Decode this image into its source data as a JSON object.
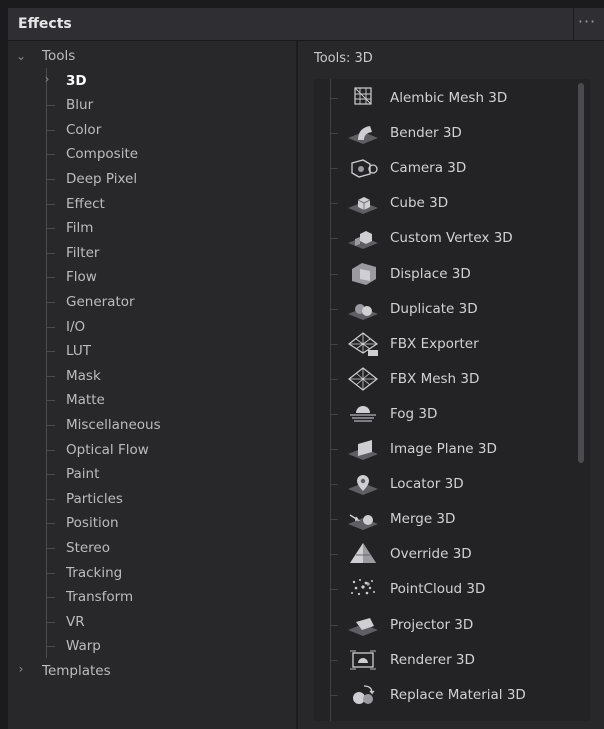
{
  "panel": {
    "title": "Effects",
    "menu_label": "···"
  },
  "tree": {
    "root": {
      "label": "Tools",
      "state": "expanded"
    },
    "items": [
      {
        "label": "3D",
        "selected": true,
        "has_children": true
      },
      {
        "label": "Blur"
      },
      {
        "label": "Color"
      },
      {
        "label": "Composite"
      },
      {
        "label": "Deep Pixel"
      },
      {
        "label": "Effect"
      },
      {
        "label": "Film"
      },
      {
        "label": "Filter"
      },
      {
        "label": "Flow"
      },
      {
        "label": "Generator"
      },
      {
        "label": "I/O"
      },
      {
        "label": "LUT"
      },
      {
        "label": "Mask"
      },
      {
        "label": "Matte"
      },
      {
        "label": "Miscellaneous"
      },
      {
        "label": "Optical Flow"
      },
      {
        "label": "Paint"
      },
      {
        "label": "Particles"
      },
      {
        "label": "Position"
      },
      {
        "label": "Stereo"
      },
      {
        "label": "Tracking"
      },
      {
        "label": "Transform"
      },
      {
        "label": "VR"
      },
      {
        "label": "Warp"
      }
    ],
    "templates": {
      "label": "Templates",
      "state": "collapsed"
    }
  },
  "list": {
    "header": "Tools: 3D",
    "tools": [
      {
        "label": "Alembic Mesh 3D",
        "icon": "alembic-mesh-icon"
      },
      {
        "label": "Bender 3D",
        "icon": "bender-icon"
      },
      {
        "label": "Camera 3D",
        "icon": "camera-icon"
      },
      {
        "label": "Cube 3D",
        "icon": "cube-icon"
      },
      {
        "label": "Custom Vertex 3D",
        "icon": "custom-vertex-icon"
      },
      {
        "label": "Displace 3D",
        "icon": "displace-icon"
      },
      {
        "label": "Duplicate 3D",
        "icon": "duplicate-icon"
      },
      {
        "label": "FBX Exporter",
        "icon": "fbx-exporter-icon"
      },
      {
        "label": "FBX Mesh 3D",
        "icon": "fbx-mesh-icon"
      },
      {
        "label": "Fog 3D",
        "icon": "fog-icon"
      },
      {
        "label": "Image Plane 3D",
        "icon": "image-plane-icon"
      },
      {
        "label": "Locator 3D",
        "icon": "locator-icon"
      },
      {
        "label": "Merge 3D",
        "icon": "merge-icon"
      },
      {
        "label": "Override 3D",
        "icon": "override-icon"
      },
      {
        "label": "PointCloud 3D",
        "icon": "pointcloud-icon"
      },
      {
        "label": "Projector 3D",
        "icon": "projector-icon"
      },
      {
        "label": "Renderer 3D",
        "icon": "renderer-icon"
      },
      {
        "label": "Replace Material 3D",
        "icon": "replace-material-icon"
      }
    ]
  },
  "colors": {
    "panel_bg": "#28282b",
    "text": "#c9c9cc",
    "selected_text": "#ffffff",
    "icon_light": "#cfcfd3",
    "icon_dark": "#6a6a70"
  }
}
